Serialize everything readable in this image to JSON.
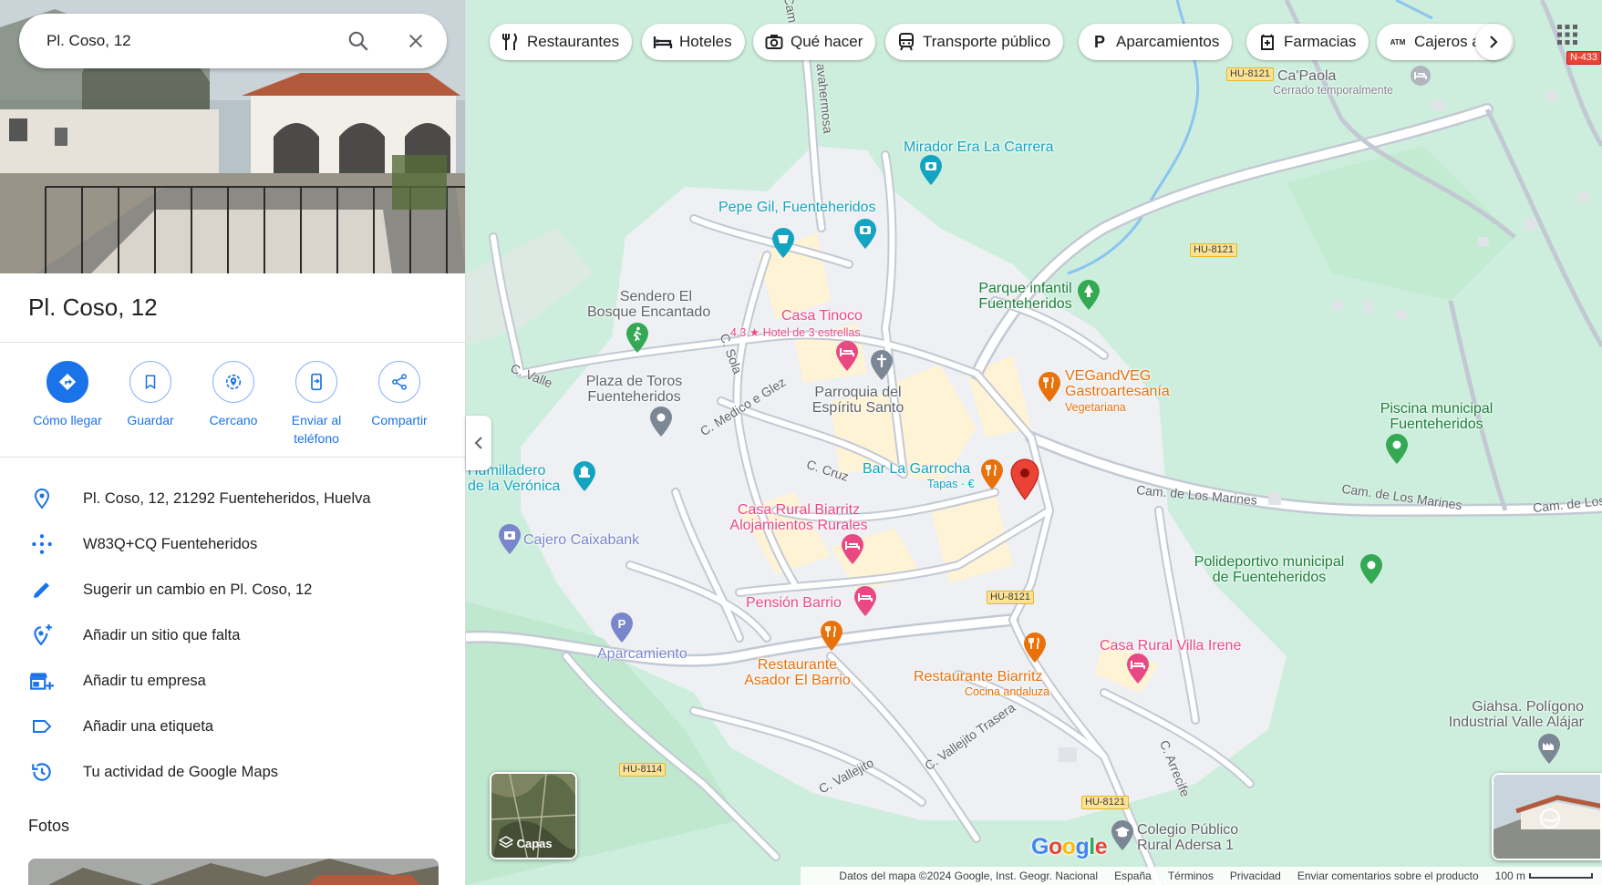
{
  "search": {
    "value": "Pl. Coso, 12"
  },
  "place": {
    "title": "Pl. Coso, 12"
  },
  "actions": [
    {
      "label": "Cómo llegar"
    },
    {
      "label": "Guardar"
    },
    {
      "label": "Cercano"
    },
    {
      "label_line1": "Enviar al",
      "label_line2": "teléfono"
    },
    {
      "label": "Compartir"
    }
  ],
  "info": {
    "address": "Pl. Coso, 12, 21292 Fuenteheridos, Huelva",
    "plus_code": "W83Q+CQ Fuenteheridos",
    "suggest_edit": "Sugerir un cambio en Pl. Coso, 12",
    "add_missing": "Añadir un sitio que falta",
    "add_business": "Añadir tu empresa",
    "add_label": "Añadir una etiqueta",
    "activity": "Tu actividad de Google Maps"
  },
  "photos_title": "Fotos",
  "chips": [
    {
      "label": "Restaurantes",
      "icon": "fork-knife-icon"
    },
    {
      "label": "Hoteles",
      "icon": "bed-icon"
    },
    {
      "label": "Qué hacer",
      "icon": "camera-icon"
    },
    {
      "label": "Transporte público",
      "icon": "train-icon"
    },
    {
      "label": "Aparcamientos",
      "icon": "parking-icon"
    },
    {
      "label": "Farmacias",
      "icon": "pharmacy-icon"
    },
    {
      "label": "Cajeros a",
      "icon": "atm-icon",
      "icon_text": "ATM"
    }
  ],
  "map": {
    "pois": {
      "mirador": "Mirador Era La Carrera",
      "pepe_gil": "Pepe Gil, Fuenteheridos",
      "sendero_1": "Sendero El",
      "sendero_2": "Bosque Encantado",
      "casa_tinoco": "Casa Tinoco",
      "casa_tinoco_rating": "4.3",
      "casa_tinoco_sub": "Hotel de 3 estrellas",
      "parque_1": "Parque infantil",
      "parque_2": "Fuenteheridos",
      "plaza_toros_1": "Plaza de Toros",
      "plaza_toros_2": "Fuenteheridos",
      "parroquia_1": "Parroquia del",
      "parroquia_2": "Espíritu Santo",
      "vegandveg_1": "VEGandVEG",
      "vegandveg_2": "Gastroartesanía",
      "vegandveg_sub": "Vegetariana",
      "bar_garrocha": "Bar La Garrocha",
      "bar_garrocha_sub": "Tapas · €",
      "humilladero_1": "Humilladero",
      "humilladero_2": "de la Verónica",
      "cajero": "Cajero Caixabank",
      "biarritz_rural_1": "Casa Rural Biarritz",
      "biarritz_rural_2": "Alojamientos Rurales",
      "piscina_1": "Piscina municipal",
      "piscina_2": "Fuenteheridos",
      "polideportivo_1": "Polideportivo municipal",
      "polideportivo_2": "de Fuenteheridos",
      "pension": "Pensión Barrio",
      "aparcamiento": "Aparcamiento",
      "asador_1": "Restaurante",
      "asador_2": "Asador El Barrio",
      "rest_biarritz": "Restaurante Biarritz",
      "rest_biarritz_sub": "Cocina andaluza",
      "villa_irene": "Casa Rural Villa Irene",
      "capaola": "Ca'Paola",
      "capaola_sub": "Cerrado temporalmente",
      "giahsa_1": "Giahsa. Polígono",
      "giahsa_2": "Industrial Valle Alájar",
      "colegio_1": "Colegio Público",
      "colegio_2": "Rural Adersa 1"
    },
    "streets": {
      "valle": "C. Valle",
      "sola": "C. Sola",
      "medico": "C. Medico e Glez",
      "cruz": "C. Cruz",
      "marines_1": "Cam. de Los Marines",
      "marines_2": "Cam. de Los Marines",
      "marines_3": "Cam. de Los",
      "vallejito": "C. Vallejito",
      "vallejito_trasera": "C. Vallejito Trasera",
      "arrecife": "C. Arrecife",
      "cam_top": "Cam.",
      "cam_avahermosa": "avahermosa"
    },
    "shields": {
      "hu8121_a": "HU-8121",
      "hu8121_b": "HU-8121",
      "hu8121_c": "HU-8121",
      "hu8121_d": "HU-8121",
      "hu8114": "HU-8114",
      "n433": "N-433"
    }
  },
  "layers_label": "Capas",
  "footer": {
    "data": "Datos del mapa ©2024 Google, Inst. Geogr. Nacional",
    "country": "España",
    "terms": "Términos",
    "privacy": "Privacidad",
    "feedback": "Enviar comentarios sobre el producto",
    "scale": "100 m"
  },
  "logo": "Google",
  "colors": {
    "accent": "#1a73e8",
    "pin": "#ea4335",
    "food": "#e8710a",
    "lodging": "#e94982",
    "attraction": "#12a4c0",
    "park": "#34a853",
    "civic": "#7986cb"
  }
}
